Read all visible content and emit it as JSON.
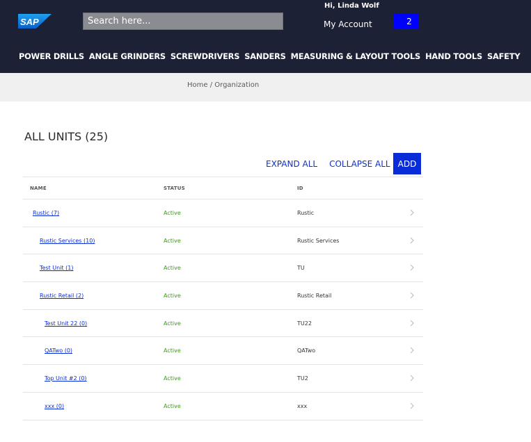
{
  "header": {
    "logo_text": "SAP",
    "search_placeholder": "Search here...",
    "greeting": "Hi, Linda Wolf",
    "account_label": "My Account",
    "cart_count": "2"
  },
  "nav": {
    "items": [
      "POWER DRILLS",
      "ANGLE GRINDERS",
      "SCREWDRIVERS",
      "SANDERS",
      "MEASURING & LAYOUT TOOLS",
      "HAND TOOLS",
      "SAFETY"
    ]
  },
  "breadcrumb": "Home / Organization",
  "page": {
    "title": "ALL UNITS (25)",
    "expand_all": "EXPAND ALL",
    "collapse_all": "COLLAPSE ALL",
    "add": "ADD"
  },
  "table": {
    "headers": {
      "name": "NAME",
      "status": "STATUS",
      "id": "ID"
    },
    "rows": [
      {
        "name": "Rustic (7)",
        "status": "Active",
        "id": "Rustic",
        "depth": 0
      },
      {
        "name": "Rustic Services (10)",
        "status": "Active",
        "id": "Rustic Services",
        "depth": 1
      },
      {
        "name": "Test Unit (1)",
        "status": "Active",
        "id": "TU",
        "depth": 1
      },
      {
        "name": "Rustic Retail (2)",
        "status": "Active",
        "id": "Rustic Retail",
        "depth": 1
      },
      {
        "name": "Test Unit 22 (0)",
        "status": "Active",
        "id": "TU22",
        "depth": 2
      },
      {
        "name": "QATwo (0)",
        "status": "Active",
        "id": "QATwo",
        "depth": 2
      },
      {
        "name": "Top Unit #2 (0)",
        "status": "Active",
        "id": "TU2",
        "depth": 2
      },
      {
        "name": "xxx (0)",
        "status": "Active",
        "id": "xxx",
        "depth": 2
      }
    ]
  },
  "colors": {
    "header_bg": "#1c2135",
    "accent": "#0a2bd8",
    "status_active": "#3b9a1b"
  },
  "icons": {
    "row_chevron": "chevron-right-icon"
  }
}
